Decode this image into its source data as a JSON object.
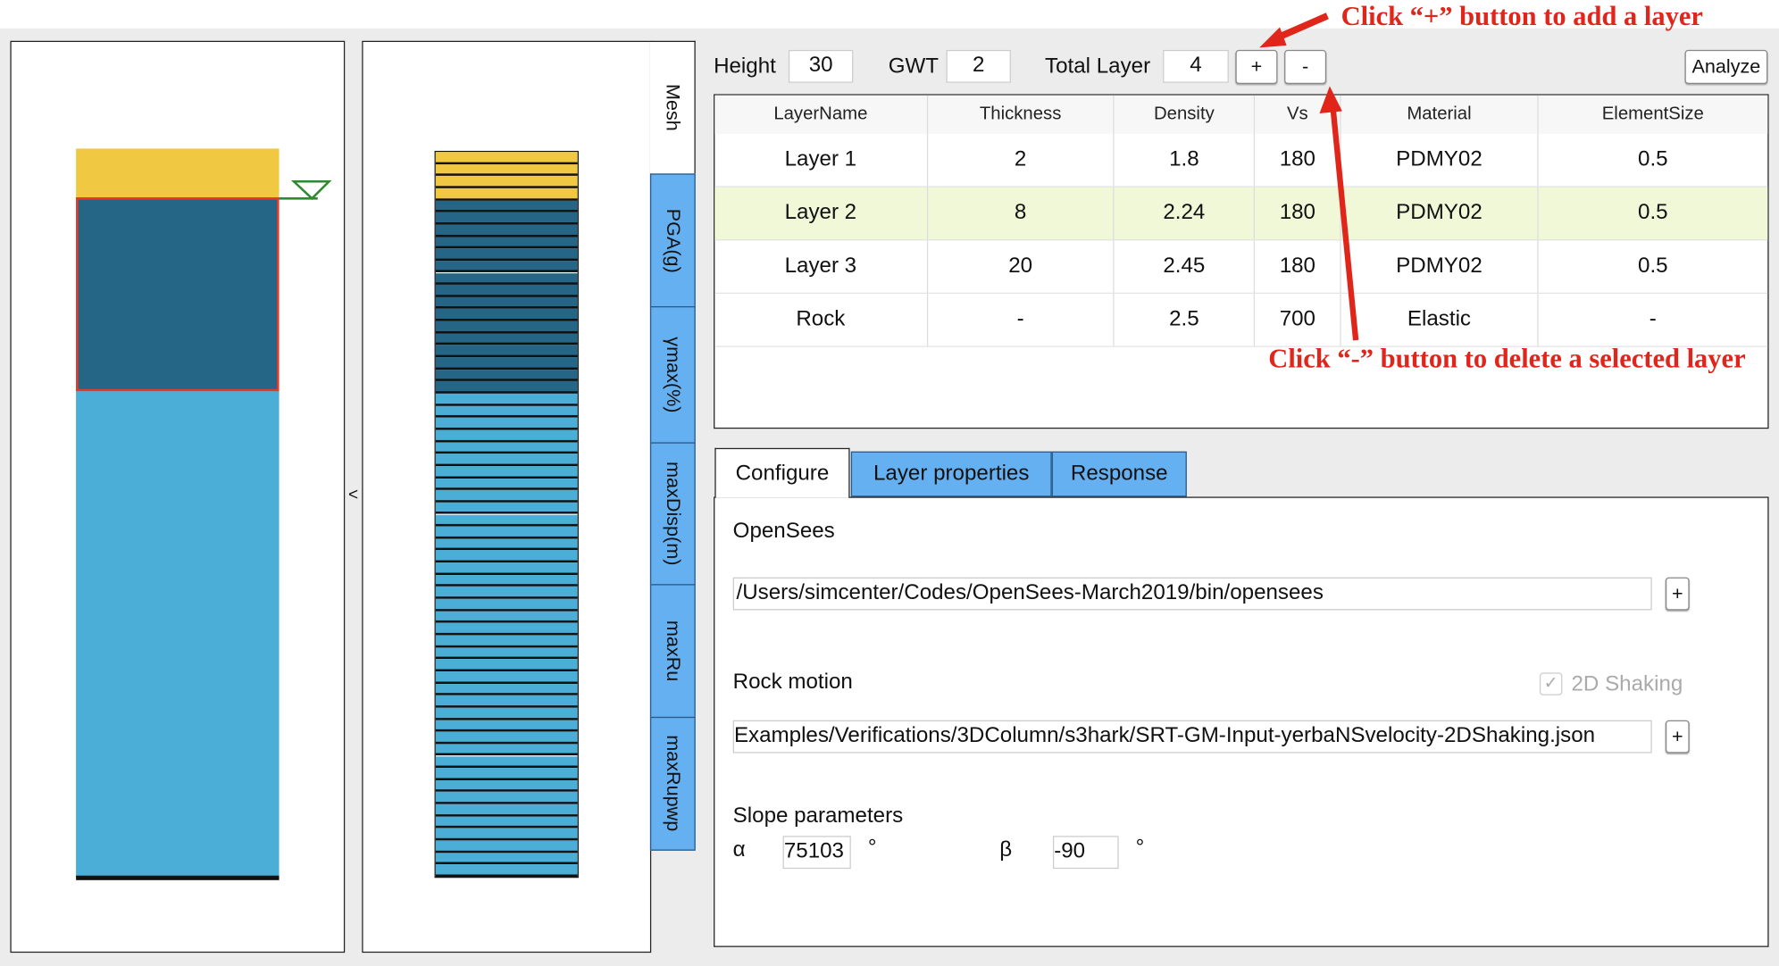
{
  "toolbar": {
    "height_label": "Height",
    "height_value": "30",
    "gwt_label": "GWT",
    "gwt_value": "2",
    "total_layer_label": "Total Layer",
    "total_layer_value": "4",
    "add_label": "+",
    "remove_label": "-",
    "analyze_label": "Analyze"
  },
  "collapse_label": "<",
  "profile": {
    "layer_colors": [
      "#f0c841",
      "#256686",
      "#4aaed6"
    ],
    "selected_border": "#e53a2a",
    "gwt_color": "#2f8a2f"
  },
  "side_tabs": [
    "Mesh",
    "PGA(g)",
    "γmax(%)",
    "maxDisp(m)",
    "maxRu",
    "maxRupwp"
  ],
  "table": {
    "columns": [
      "LayerName",
      "Thickness",
      "Density",
      "Vs",
      "Material",
      "ElementSize"
    ],
    "rows": [
      [
        "Layer 1",
        "2",
        "1.8",
        "180",
        "PDMY02",
        "0.5"
      ],
      [
        "Layer 2",
        "8",
        "2.24",
        "180",
        "PDMY02",
        "0.5"
      ],
      [
        "Layer 3",
        "20",
        "2.45",
        "180",
        "PDMY02",
        "0.5"
      ],
      [
        "Rock",
        "-",
        "2.5",
        "700",
        "Elastic",
        "-"
      ]
    ],
    "selected_row": 1,
    "selected_color": "#f0f8d8"
  },
  "tabs": [
    "Configure",
    "Layer properties",
    "Response"
  ],
  "configure": {
    "opensees_label": "OpenSees",
    "opensees_path": "/Users/simcenter/Codes/OpenSees-March2019/bin/opensees",
    "browse_label": "+",
    "rock_motion_label": "Rock motion",
    "shaking_label": "2D Shaking",
    "shaking_checked": true,
    "rock_motion_path": "Examples/Verifications/3DColumn/s3hark/SRT-GM-Input-yerbaNSvelocity-2DShaking.json",
    "slope_label": "Slope parameters",
    "alpha_label": "α",
    "alpha_value": "75103",
    "beta_label": "β",
    "beta_value": "-90",
    "degree": "°"
  },
  "annotations": {
    "add": "Click “+” button to add a layer",
    "delete": "Click “-” button to delete a selected layer",
    "color": "#e0261b"
  }
}
